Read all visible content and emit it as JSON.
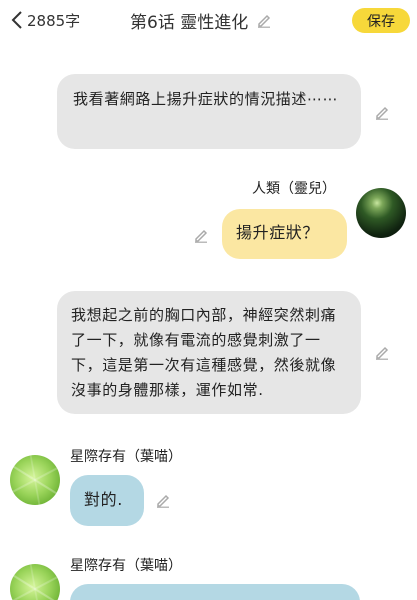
{
  "header": {
    "word_count": "2885字",
    "title": "第6话 靈性進化",
    "save_label": "保存"
  },
  "messages": [
    {
      "text": "我看著網路上揚升症狀的情況描述⋯⋯"
    },
    {
      "sender": "人類（靈兒）",
      "text": "揚升症狀？"
    },
    {
      "text": "我想起之前的胸口內部，神經突然刺痛了一下，就像有電流的感覺刺激了一下，這是第一次有這種感覺，然後就像沒事的身體那樣，運作如常."
    },
    {
      "sender": "星際存有（葉喵）",
      "text": "對的."
    },
    {
      "sender": "星際存有（葉喵）",
      "text": ""
    }
  ],
  "icons": {
    "back": "chevron-left-icon",
    "edit": "pencil-icon"
  },
  "colors": {
    "save_button": "#f7d83a",
    "narration_bubble": "#e6e6e6",
    "human_bubble": "#fbe7a2",
    "being_bubble": "#b4d8e4"
  }
}
